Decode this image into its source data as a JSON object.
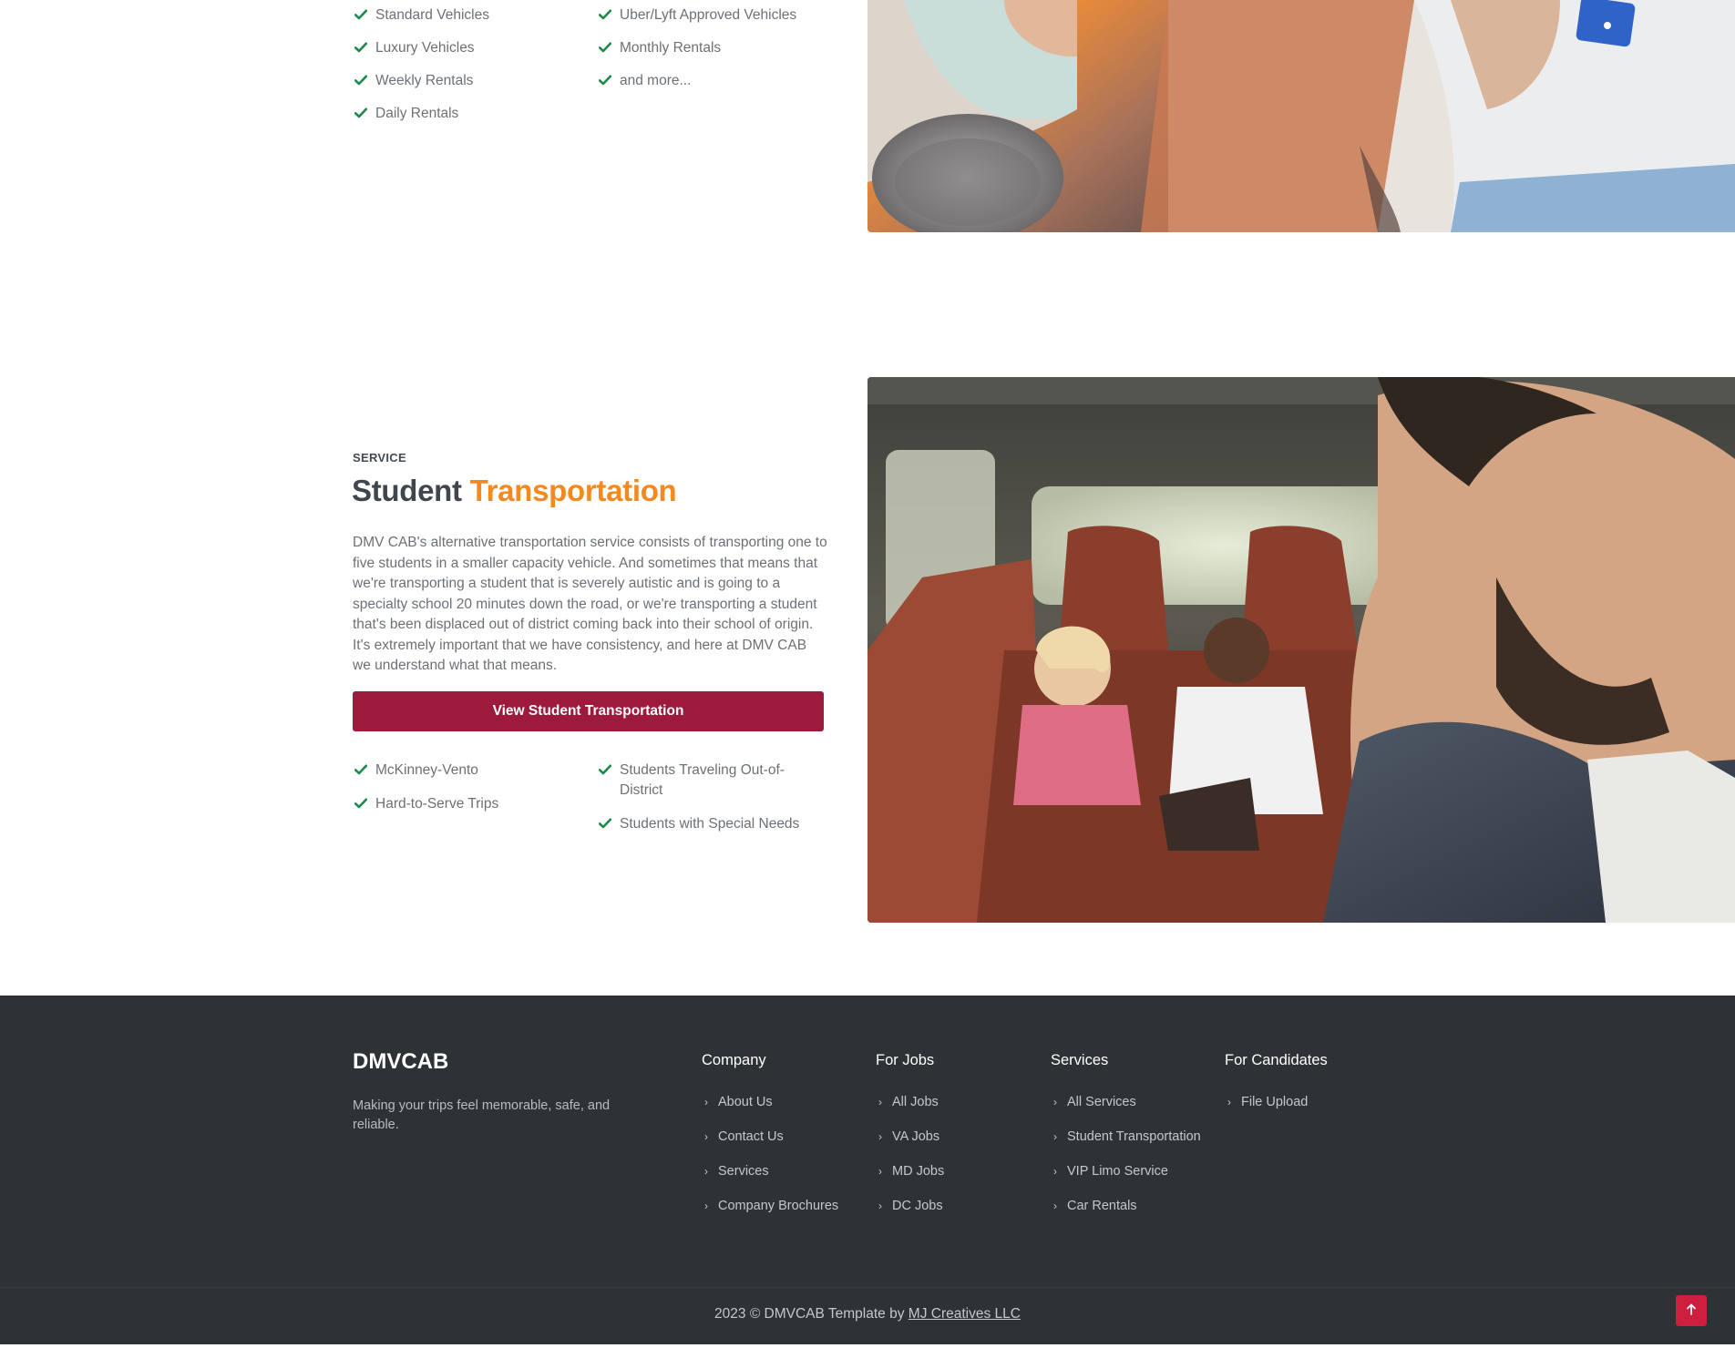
{
  "rentals": {
    "features_left": [
      "Standard Vehicles",
      "Luxury Vehicles",
      "Weekly Rentals",
      "Daily Rentals"
    ],
    "features_right": [
      "Uber/Lyft Approved Vehicles",
      "Monthly Rentals",
      "and more..."
    ]
  },
  "student_service": {
    "eyebrow": "SERVICE",
    "title_main": "Student",
    "title_accent": "Transportation",
    "description": "DMV CAB's alternative transportation service consists of transporting one to five students in a smaller capacity vehicle. And sometimes that means that we're transporting a student that is severely autistic and is going to a specialty school 20 minutes down the road, or we're transporting a student that's been displaced out of district coming back into their school of origin. It's extremely important that we have consistency, and here at DMV CAB we understand what that means.",
    "cta_label": "View Student Transportation",
    "features_left": [
      "McKinney-Vento",
      "Hard-to-Serve Trips"
    ],
    "features_right": [
      "Students Traveling Out-of-District",
      "Students with Special Needs"
    ]
  },
  "footer": {
    "brand": "DMVCAB",
    "tagline": "Making your trips feel memorable, safe, and reliable.",
    "columns": [
      {
        "heading": "Company",
        "links": [
          "About Us",
          "Contact Us",
          "Services",
          "Company Brochures"
        ]
      },
      {
        "heading": "For Jobs",
        "links": [
          "All Jobs",
          "VA Jobs",
          "MD Jobs",
          "DC Jobs"
        ]
      },
      {
        "heading": "Services",
        "links": [
          "All Services",
          "Student Transportation",
          "VIP Limo Service",
          "Car Rentals"
        ]
      },
      {
        "heading": "For Candidates",
        "links": [
          "File Upload"
        ]
      }
    ],
    "copyright_prefix": "2023 © DMVCAB Template by",
    "copyright_link": "MJ Creatives LLC"
  },
  "icons": {
    "check": "check-icon",
    "chevron": "chevron-right-icon",
    "back_to_top": "arrow-up-icon"
  },
  "colors": {
    "accent_orange": "#f4891f",
    "button_maroon": "#9c1a3c",
    "check_green": "#1e8a4c",
    "footer_bg": "#2d3235",
    "to_top_red": "#cf1f3f"
  }
}
